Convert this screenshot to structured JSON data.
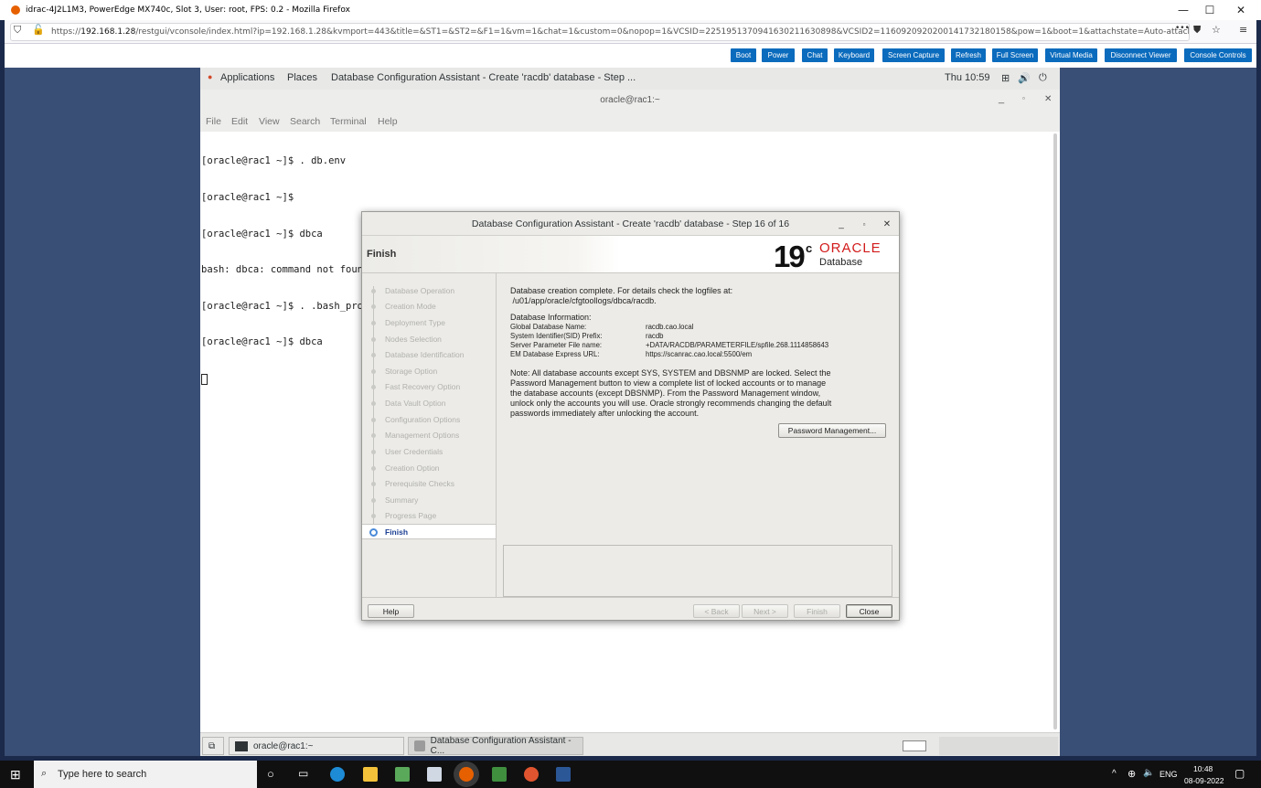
{
  "browser": {
    "title": "idrac-4J2L1M3, PowerEdge MX740c, Slot 3, User: root, FPS: 0.2 - Mozilla Firefox",
    "url_prefix": "https://",
    "url_host": "192.168.1.28",
    "url_rest": "/restgui/vconsole/index.html?ip=192.168.1.28&kvmport=443&title=&ST1=&ST2=&F1=1&vm=1&chat=1&custom=0&nopop=1&VCSID=2251951370941630211630898&VCSID2=1160920920200141732180158&pow=1&boot=1&attachstate=Auto-attach",
    "menu_dots": "•••"
  },
  "idrac_toolbar": {
    "buttons": [
      "Boot",
      "Power",
      "Chat",
      "Keyboard",
      "Screen Capture",
      "Refresh",
      "Full Screen",
      "Virtual Media",
      "Disconnect Viewer",
      "Console Controls"
    ]
  },
  "gnome_top": {
    "applications": "Applications",
    "places": "Places",
    "active_window": "Database Configuration Assistant - Create 'racdb' database - Step ...",
    "clock": "Thu 10:59"
  },
  "terminal": {
    "title": "oracle@rac1:~",
    "menu": [
      "File",
      "Edit",
      "View",
      "Search",
      "Terminal",
      "Help"
    ],
    "lines": [
      "[oracle@rac1 ~]$ . db.env",
      "[oracle@rac1 ~]$",
      "[oracle@rac1 ~]$ dbca",
      "bash: dbca: command not found...",
      "[oracle@rac1 ~]$ . .bash_profile",
      "[oracle@rac1 ~]$ dbca"
    ]
  },
  "dialog": {
    "title": "Database Configuration Assistant - Create 'racdb' database - Step 16 of 16",
    "header": "Finish",
    "logo": {
      "version": "19",
      "super": "c",
      "brand": "ORACLE",
      "product": "Database"
    },
    "steps": [
      "Database Operation",
      "Creation Mode",
      "Deployment Type",
      "Nodes Selection",
      "Database Identification",
      "Storage Option",
      "Fast Recovery Option",
      "Data Vault Option",
      "Configuration Options",
      "Management Options",
      "User Credentials",
      "Creation Option",
      "Prerequisite Checks",
      "Summary",
      "Progress Page",
      "Finish"
    ],
    "complete_line1": "Database creation complete. For details check the logfiles at:",
    "complete_line2": " /u01/app/oracle/cfgtoollogs/dbca/racdb.",
    "info_heading": "Database Information:",
    "info": [
      {
        "label": "Global Database Name:",
        "value": "racdb.cao.local"
      },
      {
        "label": "System Identifier(SID) Prefix:",
        "value": "racdb"
      },
      {
        "label": "Server Parameter File name:",
        "value": "+DATA/RACDB/PARAMETERFILE/spfile.268.1114858643"
      },
      {
        "label": "EM Database Express URL:",
        "value": "https://scanrac.cao.local:5500/em"
      }
    ],
    "note_lines": [
      "Note: All database accounts except SYS, SYSTEM and DBSNMP are locked. Select the",
      "Password Management button to view a complete list of locked accounts or to manage",
      "the database accounts (except DBSNMP). From the Password Management window,",
      "unlock only the accounts you will use. Oracle strongly recommends changing the default",
      "passwords immediately after unlocking the account."
    ],
    "password_button": "Password Management...",
    "buttons": {
      "help": "Help",
      "back": "< Back",
      "next": "Next >",
      "finish": "Finish",
      "close": "Close"
    }
  },
  "gnome_bottom": {
    "tasks": [
      "oracle@rac1:~",
      "Database Configuration Assistant - C..."
    ]
  },
  "windows_taskbar": {
    "search_placeholder": "Type here to search",
    "lang": "ENG",
    "time": "10:48",
    "date": "08-09-2022"
  }
}
